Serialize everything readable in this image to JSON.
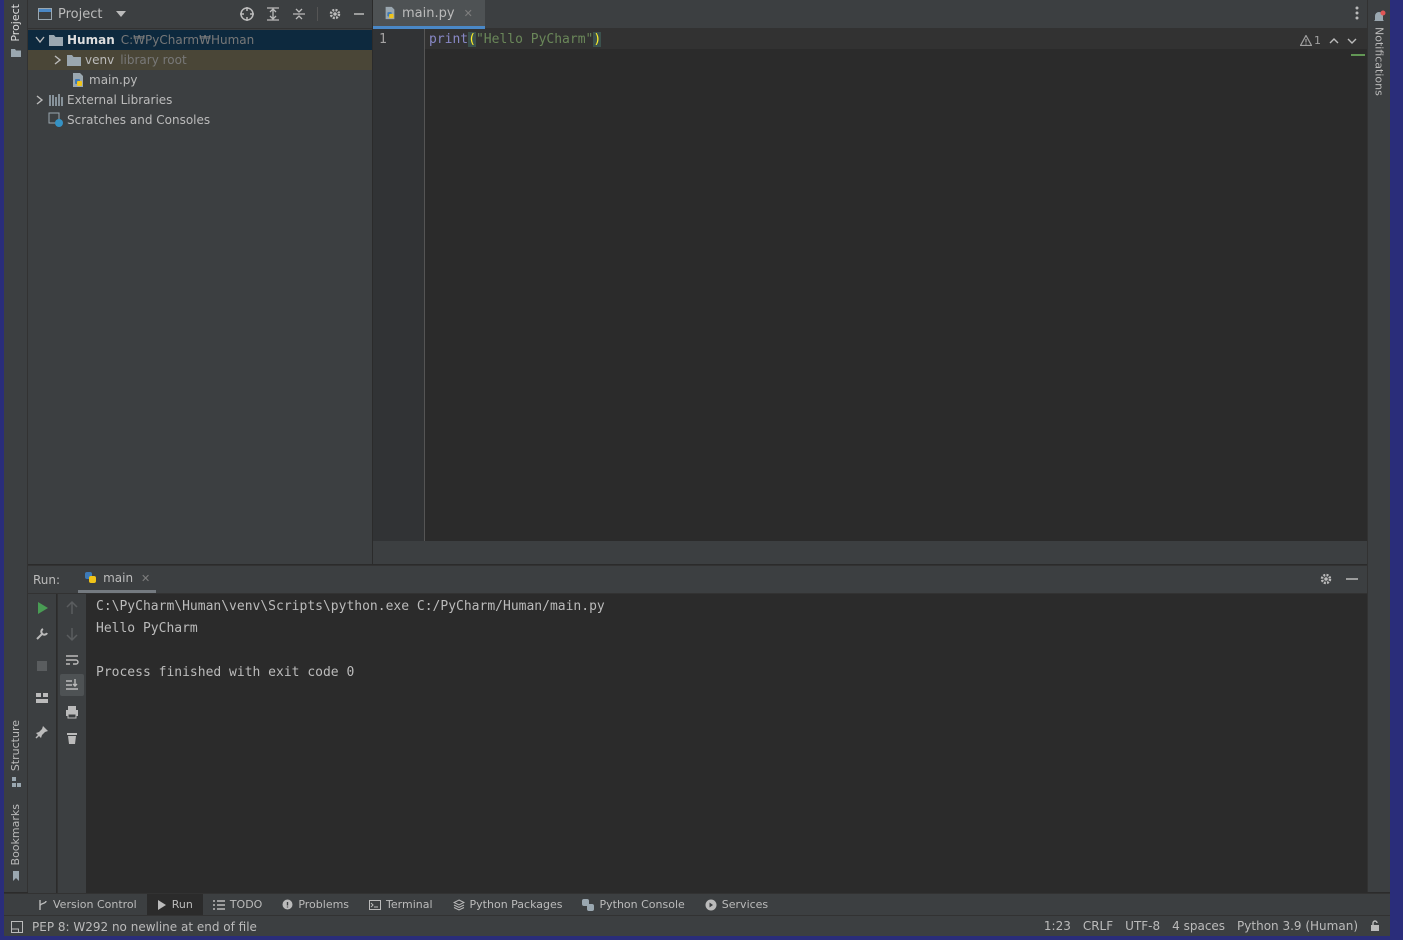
{
  "project_panel": {
    "title": "Project",
    "tree": {
      "root_name": "Human",
      "root_path": "C:₩PyCharm₩Human",
      "venv_name": "venv",
      "venv_note": "library root",
      "file_name": "main.py",
      "ext_libs": "External Libraries",
      "scratches": "Scratches and Consoles"
    }
  },
  "editor": {
    "tab_label": "main.py",
    "line_number": "1",
    "code": {
      "fn": "print",
      "open": "(",
      "str": "\"Hello PyCharm\"",
      "close": ")"
    },
    "warning_count": "1"
  },
  "run_panel": {
    "label": "Run:",
    "tab_label": "main",
    "console": {
      "line1": "C:\\PyCharm\\Human\\venv\\Scripts\\python.exe C:/PyCharm/Human/main.py",
      "line2": "Hello PyCharm",
      "line3": "",
      "line4": "Process finished with exit code 0"
    }
  },
  "left_stripe": {
    "project": "Project",
    "structure": "Structure",
    "bookmarks": "Bookmarks"
  },
  "right_stripe": {
    "notifications": "Notifications"
  },
  "bottom_bar": {
    "version_control": "Version Control",
    "run": "Run",
    "todo": "TODO",
    "problems": "Problems",
    "terminal": "Terminal",
    "python_packages": "Python Packages",
    "python_console": "Python Console",
    "services": "Services"
  },
  "status_bar": {
    "message": "PEP 8: W292 no newline at end of file",
    "position": "1:23",
    "line_sep": "CRLF",
    "encoding": "UTF-8",
    "indent": "4 spaces",
    "interpreter": "Python 3.9 (Human)"
  },
  "colors": {
    "keyword": "#8888c6",
    "string": "#6a8759",
    "accent": "#4a88c7",
    "run_green": "#499c54"
  }
}
